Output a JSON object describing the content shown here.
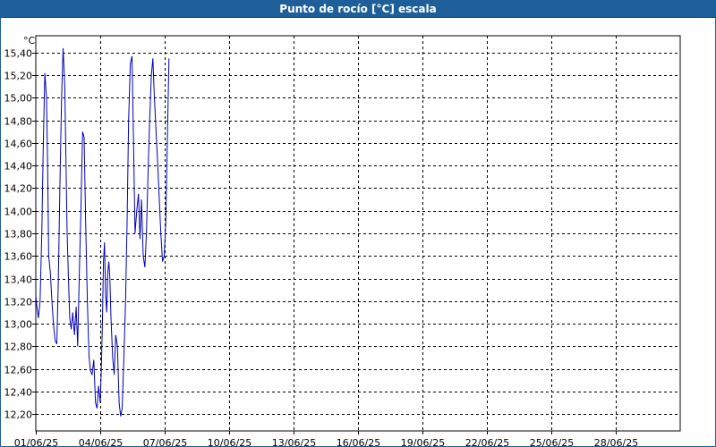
{
  "window": {
    "title": "Punto de rocío [°C] escala"
  },
  "chart_data": {
    "type": "line",
    "title": "Punto de rocío [°C] escala",
    "ylabel": "°C",
    "xlabel": "",
    "ylim": [
      12.05,
      15.55
    ],
    "yticks": [
      12.2,
      12.4,
      12.6,
      12.8,
      13.0,
      13.2,
      13.4,
      13.6,
      13.8,
      14.0,
      14.2,
      14.4,
      14.6,
      14.8,
      15.0,
      15.2,
      15.4
    ],
    "ytick_labels": [
      "12,20",
      "12,40",
      "12,60",
      "12,80",
      "13,00",
      "13,20",
      "13,40",
      "13,60",
      "13,80",
      "14,00",
      "14,20",
      "14,40",
      "14,60",
      "14,80",
      "15,00",
      "15,20",
      "15,40"
    ],
    "xlim_days": [
      0,
      30
    ],
    "xticks_days": [
      0,
      3,
      6,
      9,
      12,
      15,
      18,
      21,
      24,
      27
    ],
    "xtick_labels": [
      "01/06/25",
      "04/06/25",
      "07/06/25",
      "10/06/25",
      "13/06/25",
      "16/06/25",
      "19/06/25",
      "22/06/25",
      "25/06/25",
      "28/06/25"
    ],
    "grid": true,
    "series_color": "#0000b4",
    "series": [
      {
        "x_days": [
          0.0,
          0.05,
          0.12,
          0.2,
          0.28,
          0.35,
          0.42,
          0.5,
          0.55,
          0.6,
          0.68,
          0.75,
          0.82,
          0.9,
          0.98,
          1.05,
          1.12,
          1.2,
          1.27,
          1.35,
          1.4,
          1.46,
          1.52,
          1.58,
          1.65,
          1.72,
          1.8,
          1.88,
          1.95,
          2.02,
          2.1,
          2.18,
          2.25,
          2.32,
          2.4,
          2.48,
          2.55,
          2.62,
          2.7,
          2.78,
          2.85,
          2.92,
          3.0,
          3.05,
          3.1,
          3.15,
          3.2,
          3.25,
          3.3,
          3.35,
          3.4,
          3.45,
          3.5,
          3.58,
          3.65,
          3.72,
          3.8,
          3.88,
          3.95,
          4.02,
          4.1,
          4.18,
          4.25,
          4.32,
          4.4,
          4.48,
          4.55,
          4.62,
          4.7,
          4.78,
          4.85,
          4.92,
          5.0,
          5.08,
          5.15,
          5.22,
          5.3,
          5.38,
          5.45,
          5.52,
          5.6,
          5.68,
          5.75,
          5.82,
          5.9,
          5.98,
          6.05,
          6.12,
          6.2
        ],
        "y": [
          13.25,
          13.15,
          13.05,
          13.2,
          13.8,
          14.6,
          15.22,
          15.0,
          14.4,
          13.6,
          13.45,
          13.2,
          13.0,
          12.85,
          12.82,
          13.4,
          14.2,
          15.0,
          15.44,
          15.1,
          14.5,
          13.8,
          13.4,
          13.05,
          12.95,
          13.1,
          12.9,
          13.15,
          12.8,
          13.4,
          14.0,
          14.7,
          14.65,
          13.9,
          13.2,
          12.7,
          12.58,
          12.55,
          12.68,
          12.3,
          12.25,
          12.45,
          12.3,
          12.6,
          13.0,
          13.55,
          13.72,
          13.25,
          13.1,
          13.45,
          13.55,
          13.4,
          13.05,
          12.7,
          12.55,
          12.9,
          12.8,
          12.3,
          12.18,
          12.25,
          12.7,
          13.2,
          13.9,
          14.8,
          15.3,
          15.37,
          14.6,
          13.8,
          14.0,
          14.15,
          13.75,
          14.1,
          13.6,
          13.5,
          13.8,
          14.3,
          14.8,
          15.2,
          15.35,
          15.0,
          14.7,
          14.4,
          14.1,
          13.8,
          13.55,
          13.6,
          13.9,
          14.6,
          15.35
        ]
      }
    ]
  }
}
